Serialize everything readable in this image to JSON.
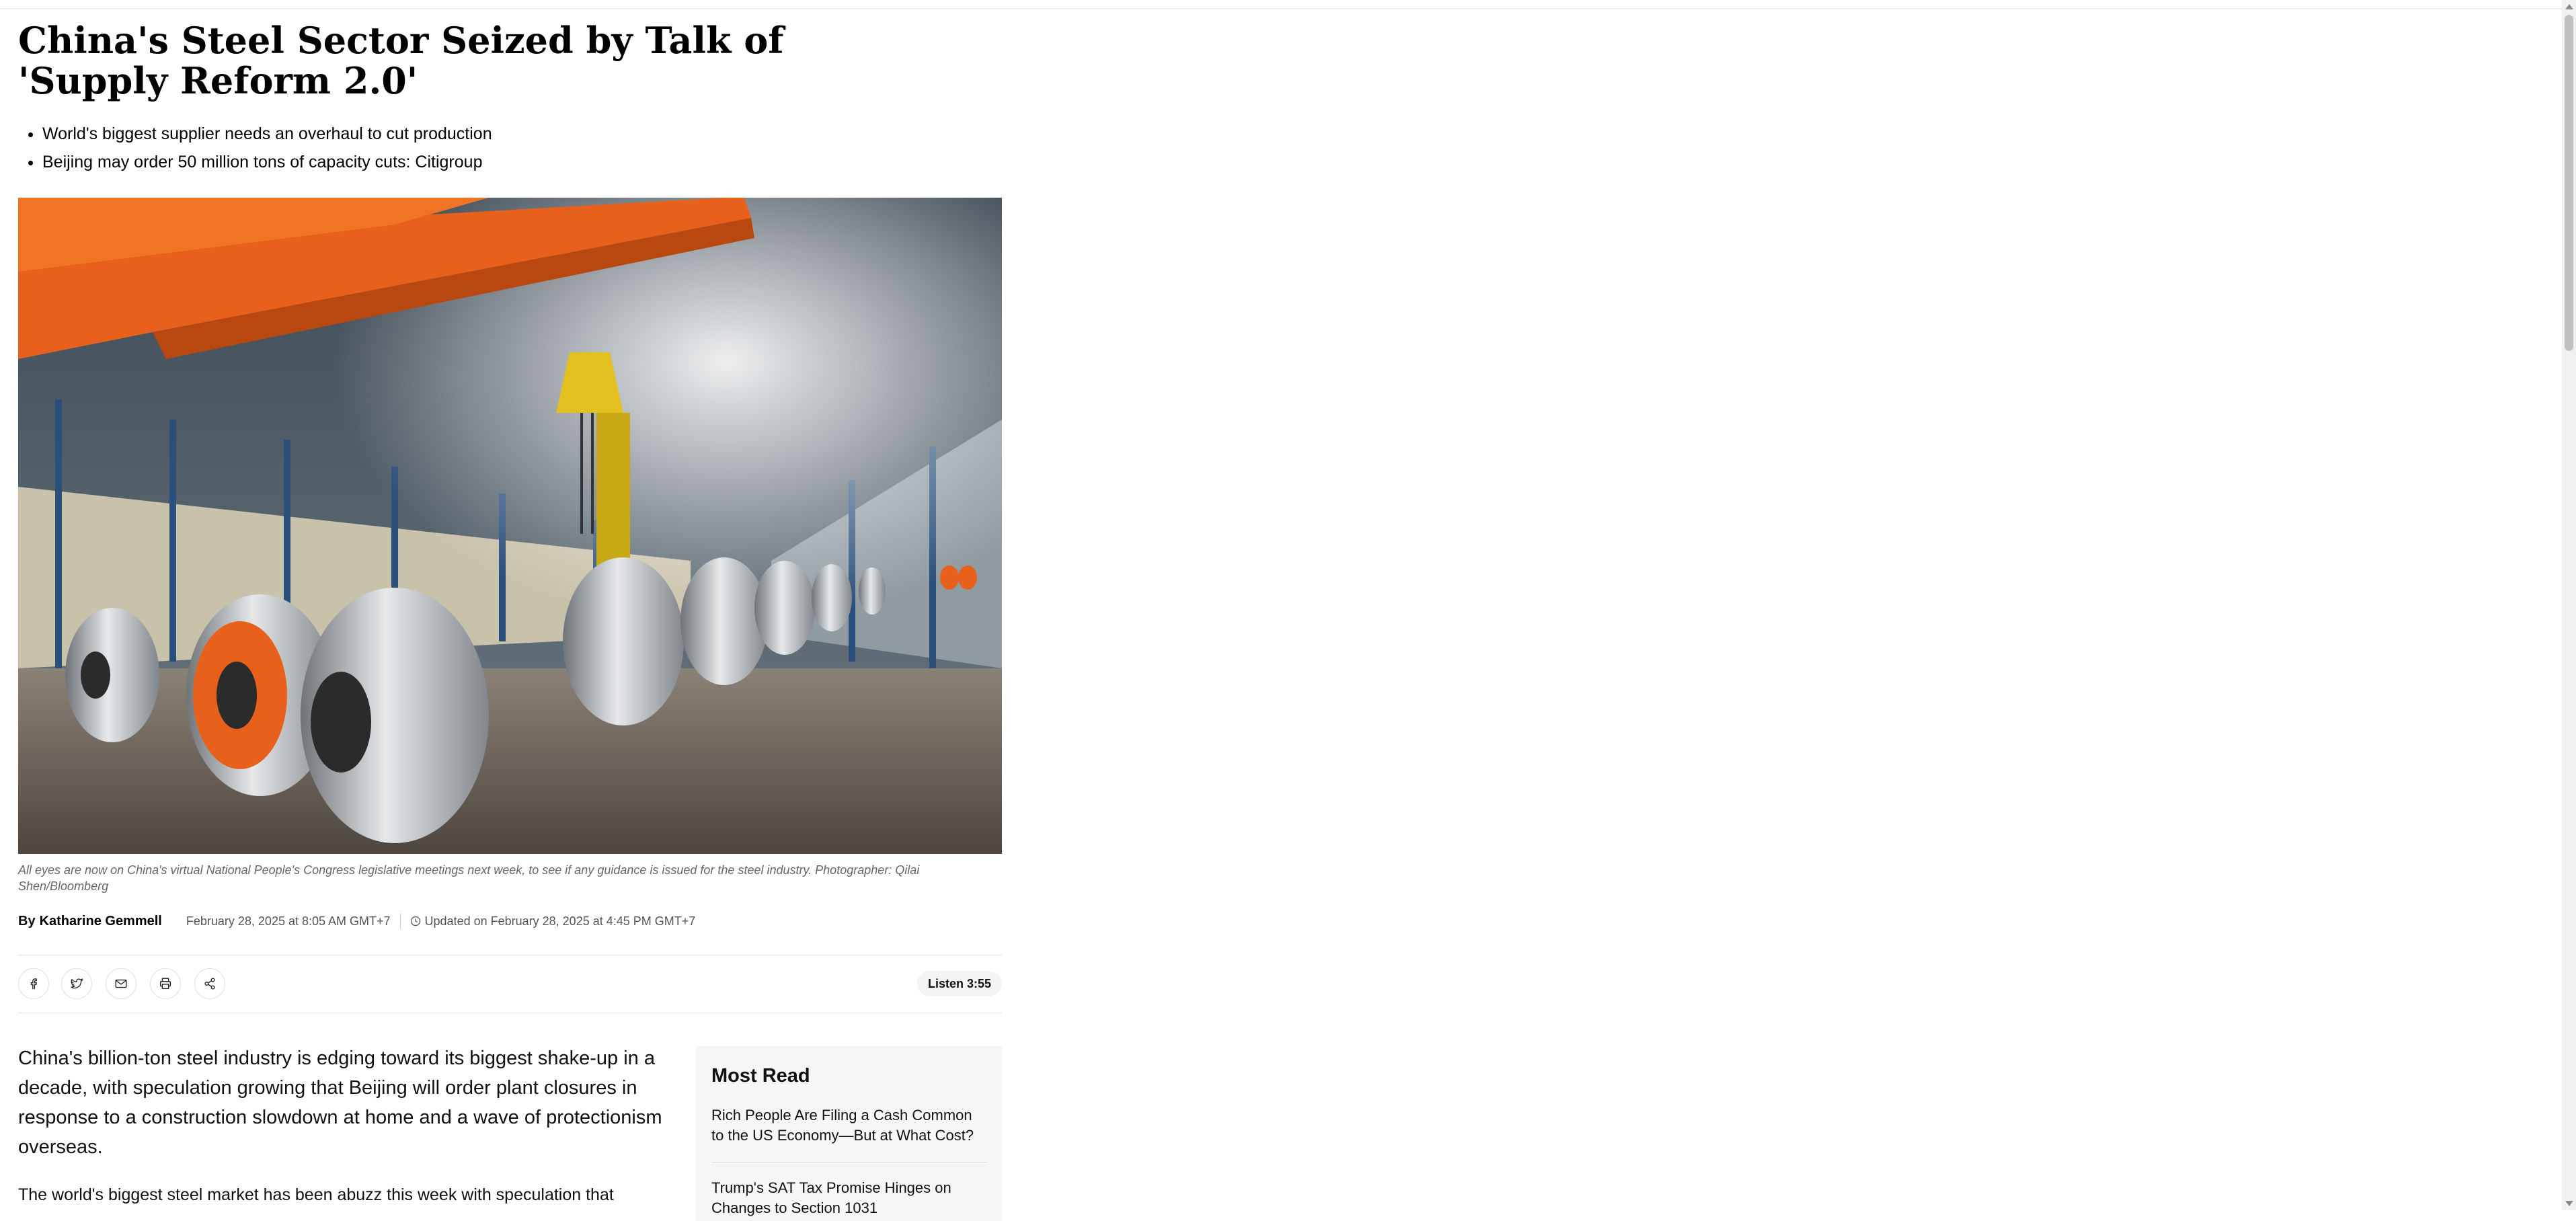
{
  "article": {
    "headline": "China's Steel Sector Seized by Talk of 'Supply Reform 2.0'",
    "bullets": [
      "World's biggest supplier needs an overhaul to cut production",
      "Beijing may order 50 million tons of capacity cuts: Citigroup"
    ],
    "caption": "All eyes are now on China's virtual National People's Congress legislative meetings next week, to see if any guidance is issued for the steel industry. Photographer: Qilai Shen/Bloomberg",
    "byline_prefix": "By",
    "author": "Katharine Gemmell",
    "published": "February 28, 2025 at 8:05 AM GMT+7",
    "updated": "Updated on February 28, 2025 at 4:45 PM GMT+7",
    "lede": "China's billion-ton steel industry is edging toward its biggest shake-up in a decade, with speculation growing that Beijing will order plant closures in response to a construction slowdown at home and a wave of protectionism overseas.",
    "paragraph2": "The world's biggest steel market has been abuzz this week with speculation that"
  },
  "share": {
    "icons": [
      "facebook-icon",
      "twitter-icon",
      "email-icon",
      "print-icon",
      "share-icon"
    ],
    "listen_label": "Listen 3:55"
  },
  "most_read": {
    "title": "Most Read",
    "items": [
      "Rich People Are Filing a Cash Common to the US Economy—But at What Cost?",
      "Trump's SAT Tax Promise Hinges on Changes to Section 1031"
    ]
  },
  "colors": {
    "crane_orange": "#e8611c",
    "steel_gray": "#b9bcc0",
    "text": "#111111",
    "muted": "#666666"
  }
}
